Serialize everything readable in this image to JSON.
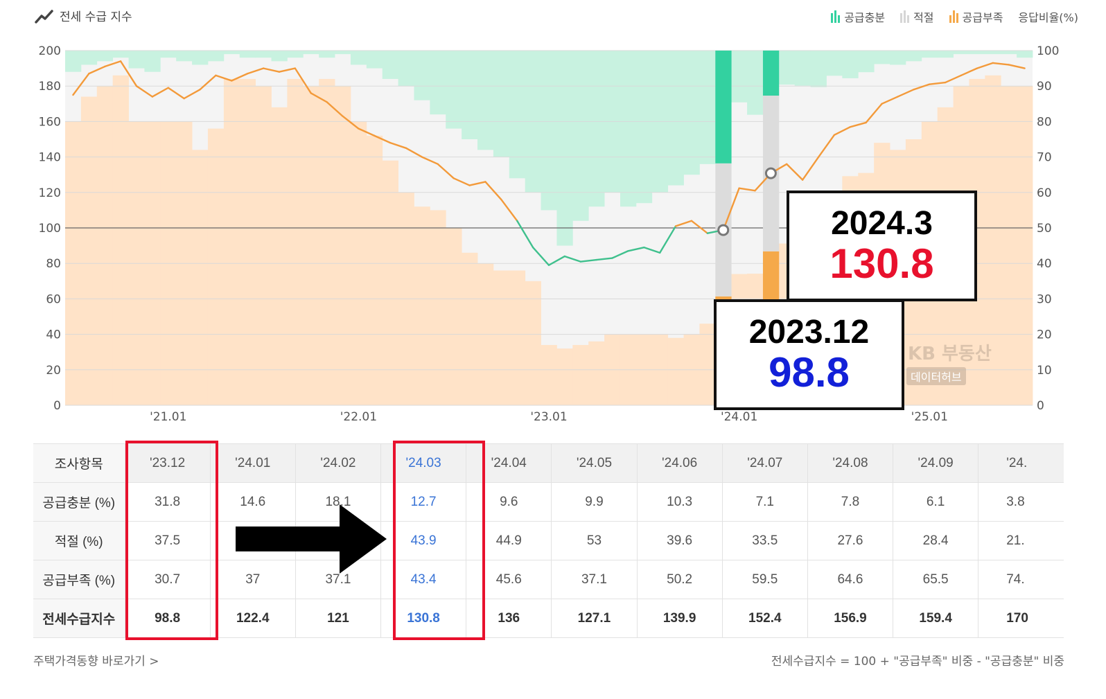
{
  "header": {
    "title": "전세 수급 지수",
    "legend": [
      {
        "label": "공급충분",
        "color": "#33d1a0",
        "icon": "bar-legend-icon"
      },
      {
        "label": "적절",
        "color": "#d6d6d6",
        "icon": "bar-legend-icon"
      },
      {
        "label": "공급부족",
        "color": "#f5a94a",
        "icon": "bar-legend-icon"
      }
    ],
    "right_axis_title": "응답비율(%)"
  },
  "callouts": [
    {
      "date": "2024.3",
      "value": "130.8"
    },
    {
      "date": "2023.12",
      "value": "98.8"
    }
  ],
  "watermark": {
    "brand": "KB 부동산",
    "sub": "데이터허브"
  },
  "chart_data": {
    "type": "bar",
    "left_axis": {
      "ticks": [
        "0",
        "20",
        "40",
        "60",
        "80",
        "100",
        "120",
        "140",
        "160",
        "180",
        "200"
      ],
      "range": [
        0,
        200
      ]
    },
    "right_axis": {
      "ticks": [
        "0",
        "10",
        "20",
        "30",
        "40",
        "50",
        "60",
        "70",
        "80",
        "90",
        "100"
      ],
      "range": [
        0,
        100
      ]
    },
    "x_ticks": [
      "'21.01",
      "'22.01",
      "'23.01",
      "'24.01",
      "'25.01"
    ],
    "reference_line": 100,
    "x_months": [
      "2020.07",
      "2020.08",
      "2020.09",
      "2020.10",
      "2020.11",
      "2020.12",
      "2021.01",
      "2021.02",
      "2021.03",
      "2021.04",
      "2021.05",
      "2021.06",
      "2021.07",
      "2021.08",
      "2021.09",
      "2021.10",
      "2021.11",
      "2021.12",
      "2022.01",
      "2022.02",
      "2022.03",
      "2022.04",
      "2022.05",
      "2022.06",
      "2022.07",
      "2022.08",
      "2022.09",
      "2022.10",
      "2022.11",
      "2022.12",
      "2023.01",
      "2023.02",
      "2023.03",
      "2023.04",
      "2023.05",
      "2023.06",
      "2023.07",
      "2023.08",
      "2023.09",
      "2023.10",
      "2023.11",
      "2023.12",
      "2024.01",
      "2024.02",
      "2024.03",
      "2024.04",
      "2024.05",
      "2024.06",
      "2024.07",
      "2024.08",
      "2024.09",
      "2024.10",
      "2024.11",
      "2024.12",
      "2025.01",
      "2025.02",
      "2025.03",
      "2025.04",
      "2025.05",
      "2025.06",
      "2025.07"
    ],
    "series": [
      {
        "name": "공급부족",
        "type": "bar",
        "axis": "right",
        "color": "#ffe3c8",
        "values": [
          80,
          87,
          90,
          93,
          80,
          80,
          80,
          80,
          72,
          78,
          92,
          92,
          90,
          84,
          92,
          90,
          92,
          90,
          80,
          76,
          69,
          60,
          56,
          55,
          50,
          43,
          40,
          38,
          38,
          35,
          17,
          16,
          17,
          18,
          20,
          20,
          20,
          20,
          19,
          20,
          23,
          30.7,
          37,
          37.1,
          43.4,
          45.6,
          37.1,
          50.2,
          59.5,
          64.6,
          65.5,
          74,
          72,
          75,
          80,
          84,
          90,
          92,
          93,
          90,
          90
        ]
      },
      {
        "name": "공급충분",
        "type": "bar",
        "axis": "right",
        "color": "#c8f2e0",
        "values": [
          6,
          4,
          3,
          2,
          5,
          6,
          2,
          3,
          4,
          3,
          1,
          2,
          2,
          3,
          2,
          1,
          2,
          1,
          4,
          5,
          8,
          10,
          14,
          18,
          22,
          25,
          28,
          30,
          36,
          40,
          45,
          55,
          48,
          44,
          40,
          44,
          43,
          40,
          38,
          35,
          32,
          31.8,
          14.6,
          18.1,
          12.7,
          9.6,
          9.9,
          10.3,
          7.1,
          7.8,
          6.1,
          3.8,
          4,
          3,
          2,
          2,
          1,
          1,
          1,
          1,
          2
        ]
      },
      {
        "name": "전세수급지수",
        "type": "line",
        "axis": "left",
        "values": [
          175,
          187,
          191,
          194,
          180,
          174,
          179,
          173,
          178,
          186,
          183,
          187,
          190,
          188,
          190,
          176,
          171,
          163,
          156,
          152,
          148,
          145,
          140,
          136,
          128,
          124,
          126,
          116,
          104,
          89,
          79,
          84,
          81,
          82,
          83,
          87,
          89,
          86,
          101,
          104,
          97,
          98.8,
          122.4,
          121,
          130.8,
          136,
          127.1,
          139.9,
          152.4,
          156.9,
          159.4,
          170,
          174,
          178,
          181,
          182,
          186,
          190,
          193,
          192,
          190
        ]
      }
    ],
    "highlight_bars": [
      {
        "month": "2023.12",
        "공급충분": 31.8,
        "적절": 37.5,
        "공급부족": 30.7,
        "index": 98.8
      },
      {
        "month": "2024.03",
        "공급충분": 12.7,
        "적절": 43.9,
        "공급부족": 43.4,
        "index": 130.8
      }
    ]
  },
  "table": {
    "header_label": "조사항목",
    "columns": [
      "'23.12",
      "'24.01",
      "'24.02",
      "'24.03",
      "'24.04",
      "'24.05",
      "'24.06",
      "'24.07",
      "'24.08",
      "'24.09",
      "'24."
    ],
    "rows": [
      {
        "label": "공급충분 (%)",
        "values": [
          "31.8",
          "14.6",
          "18.1",
          "12.7",
          "9.6",
          "9.9",
          "10.3",
          "7.1",
          "7.8",
          "6.1",
          "3.8"
        ]
      },
      {
        "label": "적절 (%)",
        "values": [
          "37.5",
          "",
          "",
          "43.9",
          "44.9",
          "53",
          "39.6",
          "33.5",
          "27.6",
          "28.4",
          "21."
        ]
      },
      {
        "label": "공급부족 (%)",
        "values": [
          "30.7",
          "37",
          "37.1",
          "43.4",
          "45.6",
          "37.1",
          "50.2",
          "59.5",
          "64.6",
          "65.5",
          "74."
        ]
      },
      {
        "label": "전세수급지수",
        "values": [
          "98.8",
          "122.4",
          "121",
          "130.8",
          "136",
          "127.1",
          "139.9",
          "152.4",
          "156.9",
          "159.4",
          "170"
        ]
      }
    ]
  },
  "footer": {
    "link": "주택가격동향 바로가기 >",
    "formula": "전세수급지수 = 100 + \"공급부족\" 비중 - \"공급충분\" 비중"
  }
}
